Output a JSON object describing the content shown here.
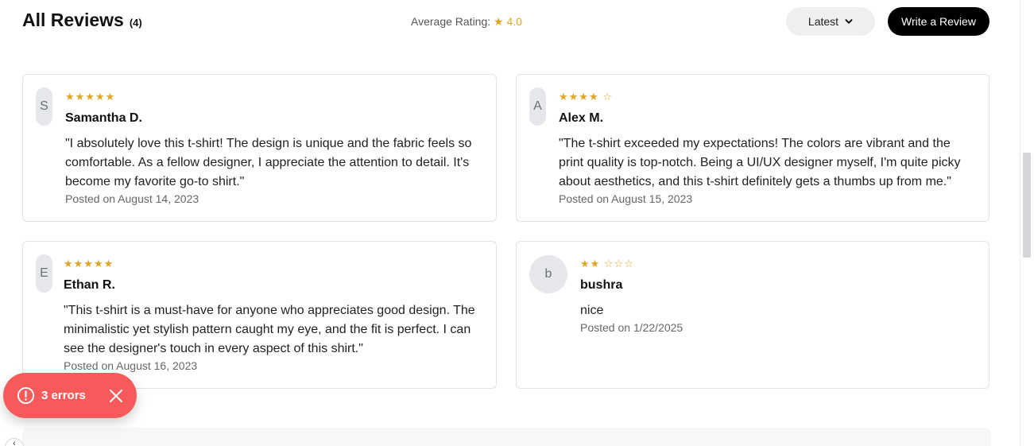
{
  "header": {
    "title": "All Reviews",
    "count": "(4)",
    "average_label": "Average Rating:",
    "average_star": "★",
    "average_value": "4.0",
    "sort_label": "Latest",
    "write_label": "Write a Review"
  },
  "reviews": [
    {
      "initial": "S",
      "stars": "★★★★★",
      "rating": 5,
      "name": "Samantha D.",
      "text": "\"I absolutely love this t-shirt! The design is unique and the fabric feels so comfortable. As a fellow designer, I appreciate the attention to detail. It's become my favorite go-to shirt.\"",
      "date": "Posted on August 14, 2023"
    },
    {
      "initial": "A",
      "stars": "★★★★ ☆",
      "rating": 4,
      "name": "Alex M.",
      "text": "\"The t-shirt exceeded my expectations! The colors are vibrant and the print quality is top-notch. Being a UI/UX designer myself, I'm quite picky about aesthetics, and this t-shirt definitely gets a thumbs up from me.\"",
      "date": "Posted on August 15, 2023"
    },
    {
      "initial": "E",
      "stars": "★★★★★",
      "rating": 5,
      "name": "Ethan R.",
      "text": "\"This t-shirt is a must-have for anyone who appreciates good design. The minimalistic yet stylish pattern caught my eye, and the fit is perfect. I can see the designer's touch in every aspect of this shirt.\"",
      "date": "Posted on August 16, 2023"
    },
    {
      "initial": "b",
      "stars": "★★ ☆☆☆",
      "rating": 2,
      "name": "bushra",
      "text": "nice",
      "date": "Posted on 1/22/2025"
    }
  ],
  "toast": {
    "label": "3 errors",
    "icon": "alert-circle-icon",
    "close_icon": "close-icon"
  },
  "colors": {
    "star": "#e0a526",
    "toast_bg": "#f65a5b",
    "write_button_bg": "#000000",
    "sort_button_bg": "#efeff1",
    "avatar_bg": "#e6e7ea"
  }
}
